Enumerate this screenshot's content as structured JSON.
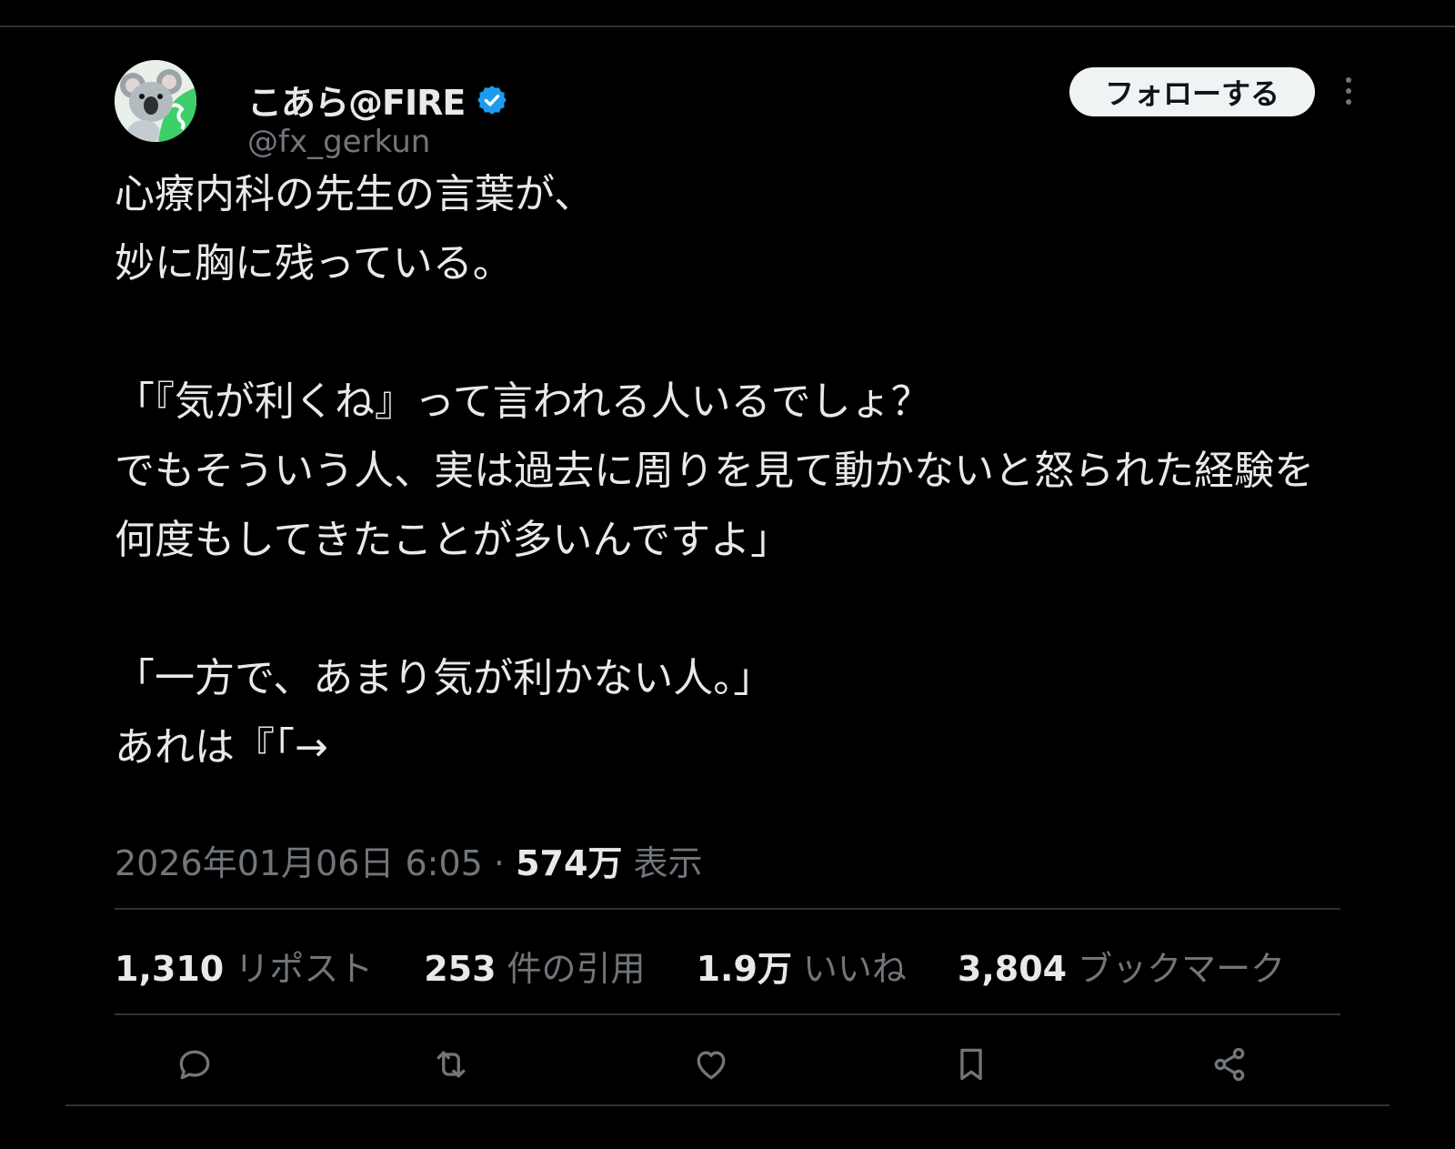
{
  "user": {
    "display_name": "こあら@FIRE",
    "handle": "@fx_gerkun",
    "verified": true,
    "avatar_icon": "koala-avatar-icon"
  },
  "follow_button": {
    "label": "フォローする"
  },
  "more_icon": "more-vertical-icon",
  "tweet": {
    "text": "心療内科の先生の言葉が、\n妙に胸に残っている。\n\n「『気が利くね』って言われる人いるでしょ？\nでもそういう人、実は過去に周りを見て動かないと怒られた経験を\n何度もしてきたことが多いんですよ」\n\n「一方で、あまり気が利かない人。」\nあれは『「→"
  },
  "meta": {
    "timestamp": "2026年01月06日 6:05",
    "separator": "·",
    "views_count": "574万",
    "views_label": "表示"
  },
  "stats": {
    "reposts": {
      "count": "1,310",
      "label": "リポスト"
    },
    "quotes": {
      "count": "253",
      "label": "件の引用"
    },
    "likes": {
      "count": "1.9万",
      "label": "いいね"
    },
    "bookmarks": {
      "count": "3,804",
      "label": "ブックマーク"
    }
  },
  "actions": [
    {
      "icon": "reply-icon"
    },
    {
      "icon": "repost-icon"
    },
    {
      "icon": "like-icon"
    },
    {
      "icon": "bookmark-icon"
    },
    {
      "icon": "share-icon"
    }
  ],
  "colors": {
    "background": "#000000",
    "text_primary": "#e7e9ea",
    "text_secondary": "#71767b",
    "divider": "#2f3336",
    "verified_blue": "#1d9bf0",
    "follow_button_bg": "#eff3f4"
  }
}
